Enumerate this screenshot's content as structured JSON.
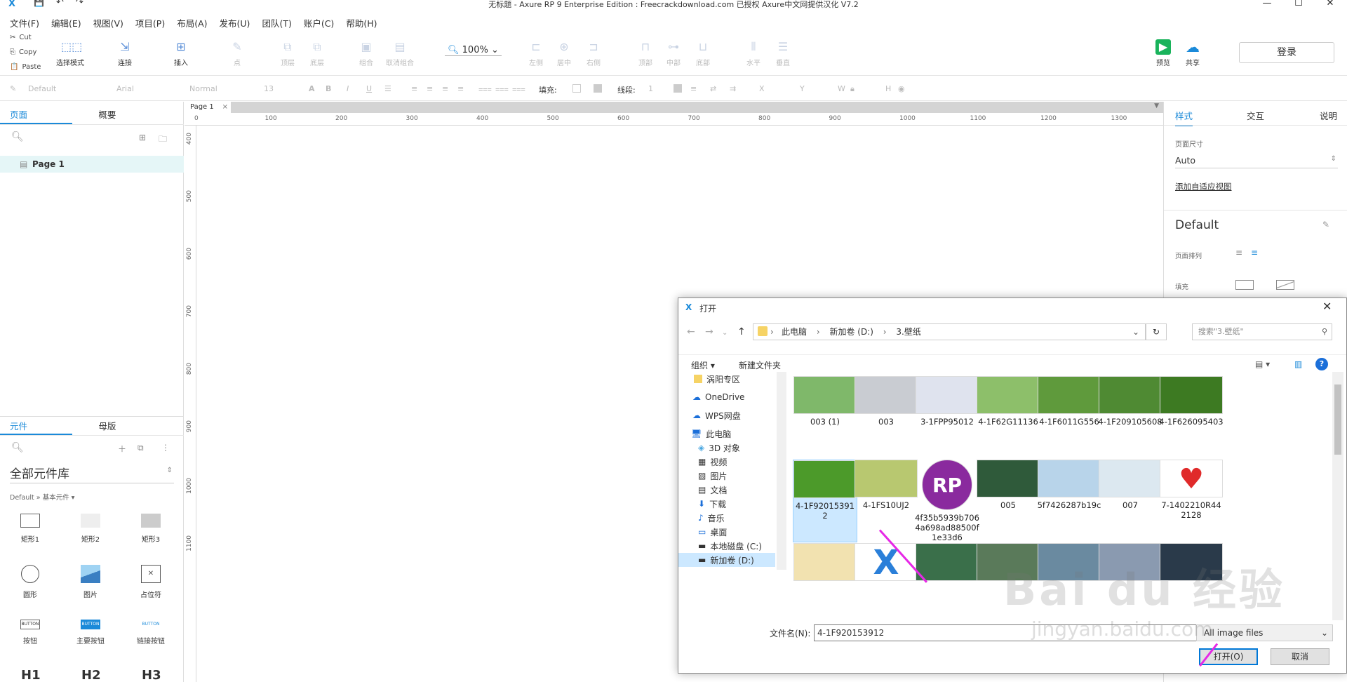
{
  "title_bar": {
    "title": "无标题 - Axure RP 9 Enterprise Edition : Freecrackdownload.com 已授权      Axure中文网提供汉化 V7.2",
    "min": "—",
    "max": "☐",
    "close": "✕"
  },
  "menu": [
    "文件(F)",
    "编辑(E)",
    "视图(V)",
    "项目(P)",
    "布局(A)",
    "发布(U)",
    "团队(T)",
    "账户(C)",
    "帮助(H)"
  ],
  "clipboard": [
    "Cut",
    "Copy",
    "Paste"
  ],
  "toolbar": {
    "select_mode": "选择模式",
    "connect": "连接",
    "insert": "插入",
    "point": "点",
    "top": "顶层",
    "bottom": "底层",
    "group": "组合",
    "ungroup": "取消组合",
    "zoom": "100%",
    "align_left": "左侧",
    "align_center": "居中",
    "align_right": "右侧",
    "align_top": "顶部",
    "align_middle": "中部",
    "align_bottom": "底部",
    "dist_h": "水平",
    "dist_v": "垂直",
    "preview": "预览",
    "share": "共享",
    "login": "登录"
  },
  "format_bar": {
    "style": "Default",
    "font": "Arial",
    "weight": "Normal",
    "size": "13",
    "fill_label": "填充:",
    "line_label": "线段:",
    "line_value": "1",
    "x": "X",
    "y": "Y",
    "w": "W",
    "h": "H"
  },
  "left_panel": {
    "tabs": [
      "页面",
      "概要"
    ],
    "page": "Page 1",
    "lib_tabs": [
      "元件",
      "母版"
    ],
    "lib_title": "全部元件库",
    "lib_path": "Default » 基本元件 ▾",
    "widgets": [
      "矩形1",
      "矩形2",
      "矩形3",
      "圆形",
      "图片",
      "占位符",
      "按钮",
      "主要按钮",
      "链接按钮"
    ],
    "button_text": "BUTTON",
    "headings": [
      "H1",
      "H2",
      "H3"
    ]
  },
  "canvas": {
    "tab": "Page 1",
    "hruler": [
      "0",
      "100",
      "200",
      "300",
      "400",
      "500",
      "600",
      "700",
      "800",
      "900",
      "1000",
      "1100",
      "1200",
      "1300"
    ],
    "vruler": [
      "400",
      "500",
      "600",
      "700",
      "800",
      "900",
      "1000",
      "1100"
    ]
  },
  "right_panel": {
    "tabs": [
      "样式",
      "交互",
      "说明"
    ],
    "page_size_label": "页面尺寸",
    "page_size": "Auto",
    "adaptive_link": "添加自适应视图",
    "style_name": "Default",
    "page_arrange": "页面排列",
    "fill": "填充"
  },
  "dialog": {
    "title": "打开",
    "breadcrumb": [
      "此电脑",
      "新加卷 (D:)",
      "3.壁纸"
    ],
    "search_placeholder": "搜索\"3.壁纸\"",
    "organize": "组织 ▾",
    "new_folder": "新建文件夹",
    "nav_items": [
      "涡阳专区",
      "OneDrive",
      "WPS网盘",
      "此电脑",
      "3D 对象",
      "视频",
      "图片",
      "文档",
      "下载",
      "音乐",
      "桌面",
      "本地磁盘 (C:)",
      "新加卷 (D:)"
    ],
    "files": [
      {
        "name": "003 (1)",
        "color": "#7fb86a"
      },
      {
        "name": "003",
        "color": "#c9ccd2"
      },
      {
        "name": "3-1FPP95012",
        "color": "#dfe3ee"
      },
      {
        "name": "4-1F62G11136",
        "color": "#8dbf6a"
      },
      {
        "name": "4-1F6011G556",
        "color": "#5f9a3c"
      },
      {
        "name": "4-1F209105608",
        "color": "#4f8a33"
      },
      {
        "name": "4-1F626095403",
        "color": "#3d7a22"
      },
      {
        "name": "4-1F920153912",
        "color": "#4c9a2a"
      },
      {
        "name": "4-1FS10UJ2",
        "color": "#b8c870"
      },
      {
        "name": "4f35b5939b7064a698ad88500f1e33d6",
        "color": "#8a2a9e"
      },
      {
        "name": "005",
        "color": "#2f5a3a"
      },
      {
        "name": "5f7426287b19c",
        "color": "#b8d4ea"
      },
      {
        "name": "007",
        "color": "#dce8f0"
      },
      {
        "name": "7-1402210R442128",
        "color": "#ffffff"
      },
      {
        "name": "",
        "color": "#f2e2b0"
      },
      {
        "name": "",
        "color": "#ffffff"
      },
      {
        "name": "",
        "color": "#3a6f4a"
      },
      {
        "name": "",
        "color": "#5a7a5a"
      },
      {
        "name": "",
        "color": "#6a8aa0"
      },
      {
        "name": "",
        "color": "#8a9ab0"
      },
      {
        "name": "",
        "color": "#2a3a4a"
      }
    ],
    "filename_label": "文件名(N):",
    "filename": "4-1F920153912",
    "filetype": "All image files",
    "open": "打开(O)",
    "cancel": "取消"
  },
  "watermark": {
    "brand": "Bai  du 经验",
    "url": "jingyan.baidu.com"
  }
}
